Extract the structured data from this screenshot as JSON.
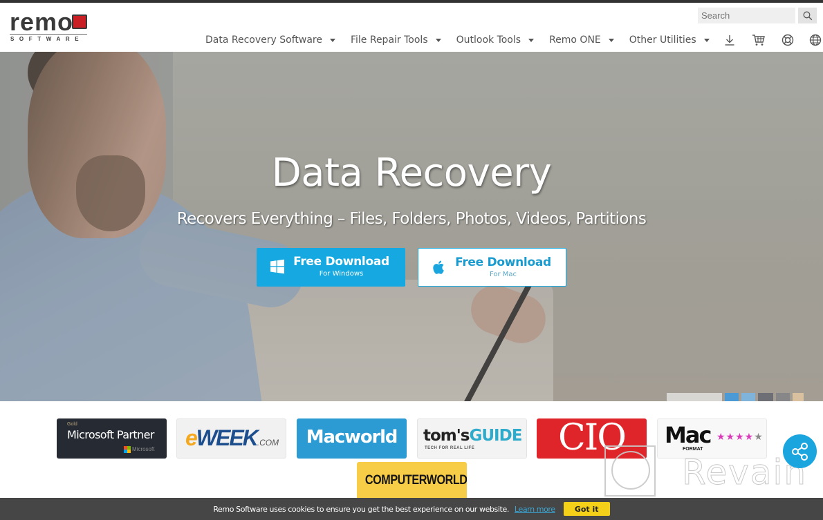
{
  "brand": {
    "logo_word": "remo",
    "logo_sub": "SOFTWARE",
    "accent": "#c81e24"
  },
  "search": {
    "placeholder": "Search",
    "value": ""
  },
  "nav": {
    "items": [
      {
        "label": "Data Recovery Software",
        "icon": "chevron-down-icon"
      },
      {
        "label": "File Repair Tools",
        "icon": "chevron-down-icon"
      },
      {
        "label": "Outlook Tools",
        "icon": "chevron-down-icon"
      },
      {
        "label": "Remo ONE",
        "icon": "chevron-down-icon"
      },
      {
        "label": "Other Utilities",
        "icon": "chevron-down-icon"
      }
    ],
    "icons": [
      "download-icon",
      "cart-icon",
      "support-icon",
      "globe-icon"
    ]
  },
  "hero": {
    "title": "Data Recovery",
    "subtitle": "Recovers Everything – Files, Folders, Photos, Videos, Partitions",
    "buttons": [
      {
        "main": "Free Download",
        "minor": "For Windows",
        "icon": "windows-icon",
        "color": "#16a9e1"
      },
      {
        "main": "Free Download",
        "minor": "For Mac",
        "icon": "apple-icon",
        "color": "#ffffff"
      }
    ]
  },
  "press": {
    "microsoft": {
      "tier": "Gold",
      "name": "Microsoft Partner",
      "brand": "Microsoft"
    },
    "eweek": {
      "e": "e",
      "word": "WEEK",
      "suffix": ".COM"
    },
    "macworld": {
      "name": "Macworld"
    },
    "tomsguide": {
      "a": "tom's",
      "b": "GUIDE",
      "tag": "TECH FOR REAL LIFE"
    },
    "cio": {
      "name": "CIO"
    },
    "macformat": {
      "mac": "Mac",
      "format": "FORMAT",
      "stars": "★★★★",
      "half": "★",
      "rating": 4.5
    },
    "computerworld": {
      "name": "COMPUTERWORLD"
    }
  },
  "watermark": {
    "text": "Revain"
  },
  "cookie": {
    "text": "Remo Software uses cookies to ensure you get the best experience on our website.",
    "link": "Learn more",
    "button": "Got it"
  }
}
